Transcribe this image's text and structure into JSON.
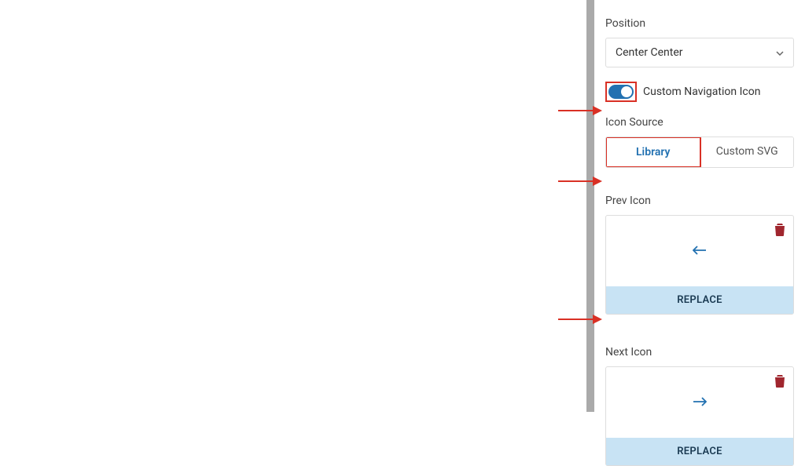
{
  "position": {
    "label": "Position",
    "value": "Center Center"
  },
  "toggle": {
    "label": "Custom Navigation Icon",
    "on": true
  },
  "iconSource": {
    "label": "Icon Source",
    "options": [
      {
        "label": "Library",
        "active": true
      },
      {
        "label": "Custom SVG",
        "active": false
      }
    ]
  },
  "prevIcon": {
    "label": "Prev Icon",
    "replace": "REPLACE"
  },
  "nextIcon": {
    "label": "Next Icon",
    "replace": "REPLACE"
  },
  "colors": {
    "accent": "#2271b1",
    "highlight": "#d93025",
    "replaceBg": "#c8e3f4"
  }
}
